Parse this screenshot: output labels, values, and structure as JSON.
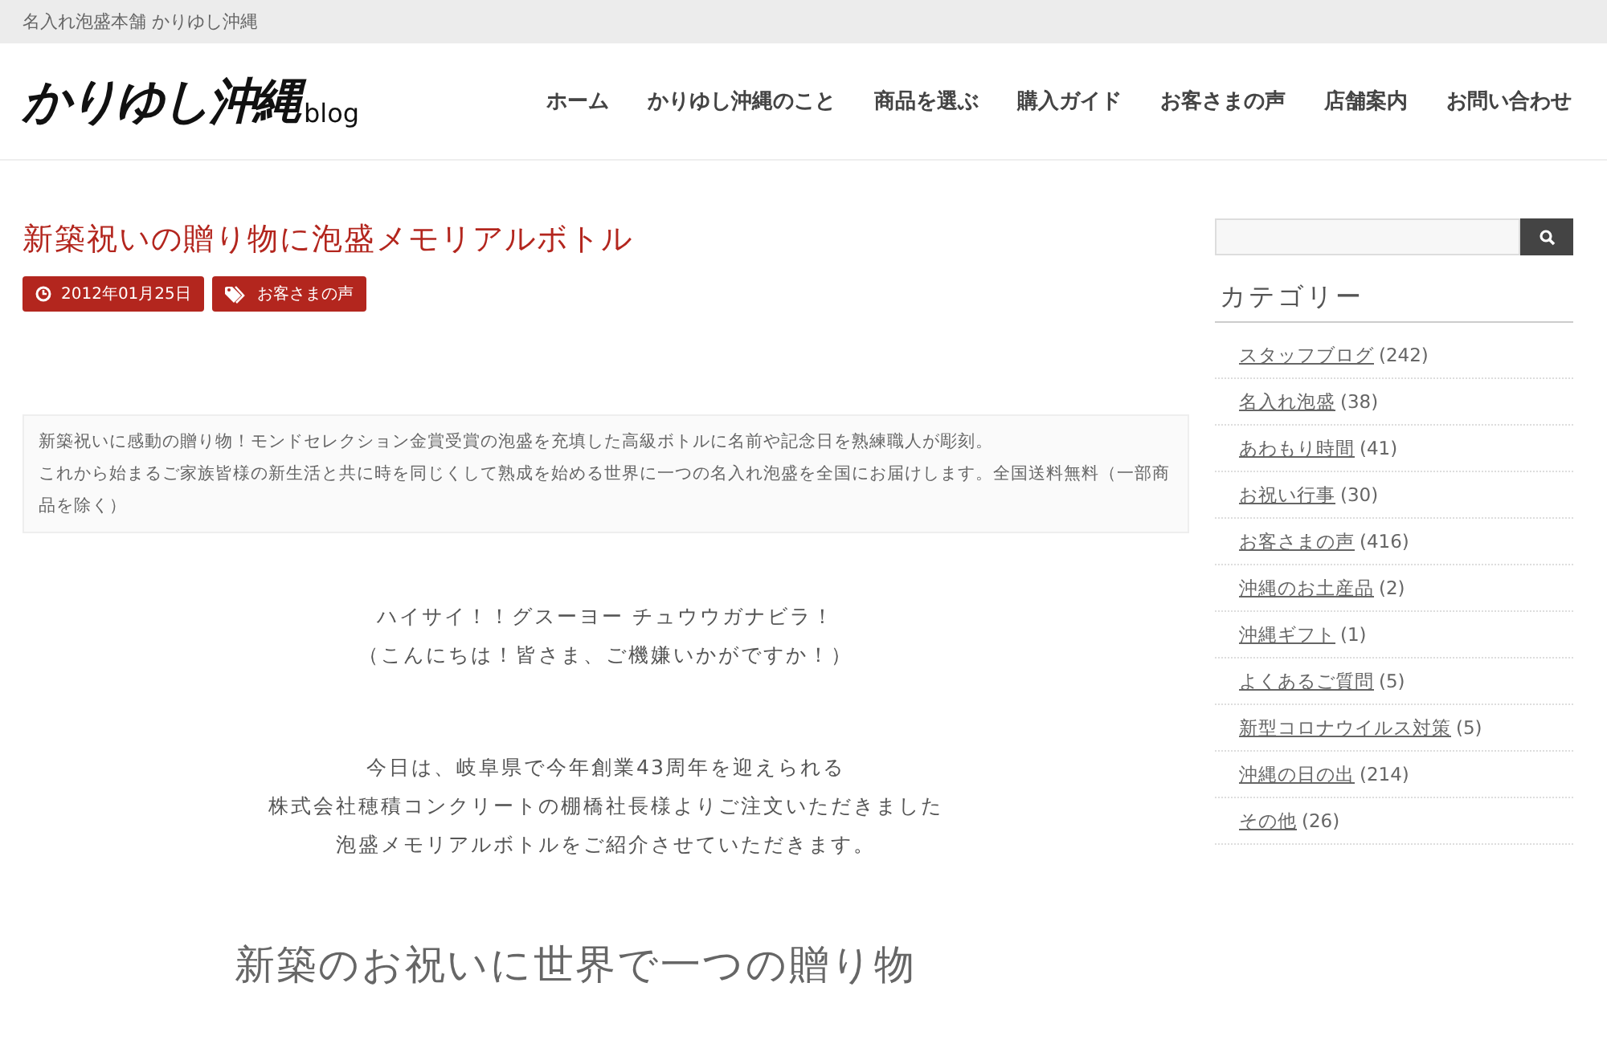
{
  "topbar": {
    "text": "名入れ泡盛本舗 かりゆし沖縄"
  },
  "header": {
    "logo": "かりゆし沖縄",
    "logo_suffix": "blog",
    "nav": [
      {
        "label": "ホーム"
      },
      {
        "label": "かりゆし沖縄のこと"
      },
      {
        "label": "商品を選ぶ"
      },
      {
        "label": "購入ガイド"
      },
      {
        "label": "お客さまの声"
      },
      {
        "label": "店舗案内"
      },
      {
        "label": "お問い合わせ"
      }
    ]
  },
  "article": {
    "title": "新築祝いの贈り物に泡盛メモリアルボトル",
    "date": "2012年01月25日",
    "category": "お客さまの声",
    "summary": [
      "新築祝いに感動の贈り物！モンドセレクション金賞受賞の泡盛を充填した高級ボトルに名前や記念日を熟練職人が彫刻。",
      "これから始まるご家族皆様の新生活と共に時を同じくして熟成を始める世界に一つの名入れ泡盛を全国にお届けします。全国送料無料（一部商品を除く）"
    ],
    "paragraphs": [
      [
        "ハイサイ！！グスーヨー チュウウガナビラ！",
        "（こんにちは！皆さま、ご機嫌いかがですか！）"
      ],
      [
        "今日は、岐阜県で今年創業43周年を迎えられる",
        "株式会社穂積コンクリートの棚橋社長様よりご注文いただきました",
        "泡盛メモリアルボトルをご紹介させていただきます。"
      ]
    ],
    "heading": "新築のお祝いに世界で一つの贈り物"
  },
  "sidebar": {
    "categories_title": "カテゴリー",
    "categories": [
      {
        "name": "スタッフブログ",
        "count": "(242)"
      },
      {
        "name": "名入れ泡盛",
        "count": "(38)"
      },
      {
        "name": "あわもり時間",
        "count": "(41)"
      },
      {
        "name": "お祝い行事",
        "count": "(30)"
      },
      {
        "name": "お客さまの声",
        "count": "(416)"
      },
      {
        "name": "沖縄のお土産品",
        "count": "(2)"
      },
      {
        "name": "沖縄ギフト",
        "count": "(1)"
      },
      {
        "name": "よくあるご質問",
        "count": "(5)"
      },
      {
        "name": "新型コロナウイルス対策",
        "count": "(5)"
      },
      {
        "name": "沖縄の日の出",
        "count": "(214)"
      },
      {
        "name": "その他",
        "count": "(26)"
      }
    ]
  }
}
